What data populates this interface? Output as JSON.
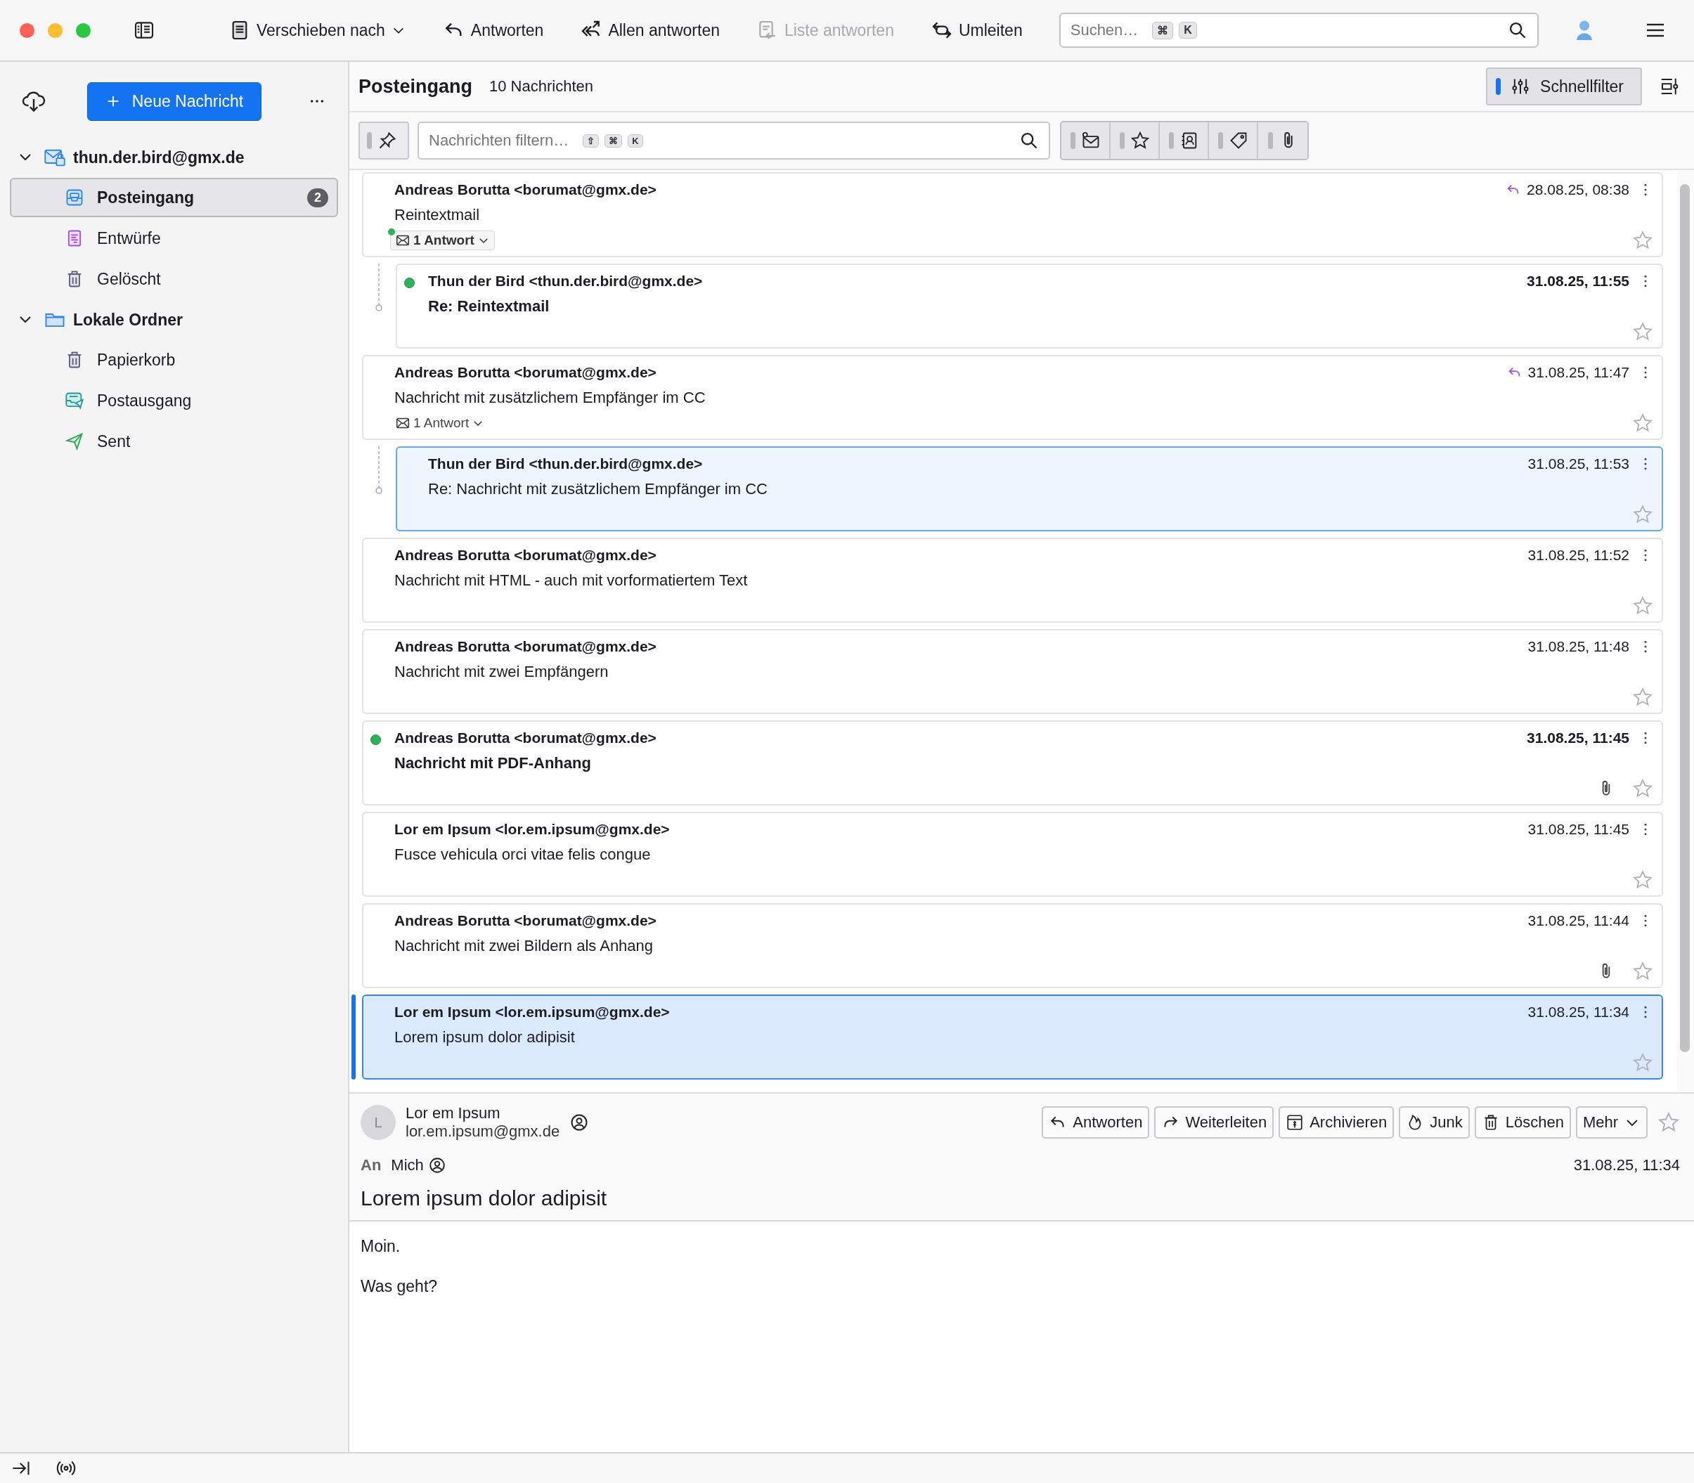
{
  "toolbar": {
    "buttons": [
      {
        "kind": "move",
        "label": "Verschieben nach",
        "disabled": false
      },
      {
        "kind": "reply",
        "label": "Antworten",
        "disabled": false
      },
      {
        "kind": "reply-all",
        "label": "Allen antworten",
        "disabled": false
      },
      {
        "kind": "reply-list",
        "label": "Liste antworten",
        "disabled": true
      },
      {
        "kind": "redirect",
        "label": "Umleiten",
        "disabled": false
      }
    ],
    "search": {
      "placeholder": "Suchen…",
      "keys": [
        "⌘",
        "K"
      ]
    }
  },
  "folder_pane": {
    "new_message": "Neue Nachricht",
    "accounts": [
      {
        "name": "thun.der.bird@gmx.de",
        "kind": "mail",
        "expanded": true,
        "children": [
          {
            "name": "Posteingang",
            "kind": "inbox",
            "selected": true,
            "unread_count": "2"
          },
          {
            "name": "Entwürfe",
            "kind": "drafts",
            "selected": false
          },
          {
            "name": "Gelöscht",
            "kind": "trash",
            "selected": false
          }
        ]
      },
      {
        "name": "Lokale Ordner",
        "kind": "local",
        "expanded": true,
        "children": [
          {
            "name": "Papierkorb",
            "kind": "trash",
            "selected": false
          },
          {
            "name": "Postausgang",
            "kind": "outbox",
            "selected": false
          },
          {
            "name": "Sent",
            "kind": "sent",
            "selected": false
          }
        ]
      }
    ]
  },
  "list_header": {
    "folder": "Posteingang",
    "count": "10 Nachrichten",
    "quick_filter": {
      "label": "Schnellfilter",
      "on": true
    }
  },
  "filter_bar": {
    "pinned": false,
    "placeholder": "Nachrichten filtern…",
    "keys": [
      "⇧",
      "⌘",
      "K"
    ],
    "toggles": [
      {
        "kind": "unread",
        "on": false
      },
      {
        "kind": "starred",
        "on": false
      },
      {
        "kind": "contact",
        "on": false
      },
      {
        "kind": "tags",
        "on": false
      },
      {
        "kind": "attachment",
        "on": false
      }
    ]
  },
  "messages": [
    {
      "sender": "Andreas Borutta <borumat@gmx.de>",
      "subject": "Reintextmail",
      "date": "28.08.25, 08:38",
      "unread": false,
      "replied": true,
      "selected": false,
      "highlighted": false,
      "attachment": false,
      "starred": false,
      "replies": {
        "label": "1 Antwort",
        "unread": true
      },
      "children": [
        {
          "sender": "Thun der Bird <thun.der.bird@gmx.de>",
          "subject": "Re: Reintextmail",
          "date": "31.08.25, 11:55",
          "unread": true,
          "replied": false,
          "selected": false,
          "highlighted": false,
          "attachment": false,
          "starred": false
        }
      ]
    },
    {
      "sender": "Andreas Borutta <borumat@gmx.de>",
      "subject": "Nachricht mit zusätzlichem Empfänger im CC",
      "date": "31.08.25, 11:47",
      "unread": false,
      "replied": true,
      "selected": false,
      "highlighted": false,
      "attachment": false,
      "starred": false,
      "replies": {
        "label": "1 Antwort",
        "unread": false
      },
      "children": [
        {
          "sender": "Thun der Bird <thun.der.bird@gmx.de>",
          "subject": "Re: Nachricht mit zusätzlichem Empfänger im CC",
          "date": "31.08.25, 11:53",
          "unread": false,
          "replied": false,
          "selected": false,
          "highlighted": true,
          "attachment": false,
          "starred": false
        }
      ]
    },
    {
      "sender": "Andreas Borutta <borumat@gmx.de>",
      "subject": "Nachricht mit HTML - auch mit vorformatiertem Text",
      "date": "31.08.25, 11:52",
      "unread": false,
      "replied": false,
      "selected": false,
      "highlighted": false,
      "attachment": false,
      "starred": false
    },
    {
      "sender": "Andreas Borutta <borumat@gmx.de>",
      "subject": "Nachricht mit zwei Empfängern",
      "date": "31.08.25, 11:48",
      "unread": false,
      "replied": false,
      "selected": false,
      "highlighted": false,
      "attachment": false,
      "starred": false
    },
    {
      "sender": "Andreas Borutta <borumat@gmx.de>",
      "subject": "Nachricht mit PDF-Anhang",
      "date": "31.08.25, 11:45",
      "unread": true,
      "replied": false,
      "selected": false,
      "highlighted": false,
      "attachment": true,
      "starred": false
    },
    {
      "sender": "Lor em Ipsum <lor.em.ipsum@gmx.de>",
      "subject": "Fusce vehicula orci vitae felis congue",
      "date": "31.08.25, 11:45",
      "unread": false,
      "replied": false,
      "selected": false,
      "highlighted": false,
      "attachment": false,
      "starred": false
    },
    {
      "sender": "Andreas Borutta <borumat@gmx.de>",
      "subject": "Nachricht mit zwei Bildern als Anhang",
      "date": "31.08.25, 11:44",
      "unread": false,
      "replied": false,
      "selected": false,
      "highlighted": false,
      "attachment": true,
      "starred": false
    },
    {
      "sender": "Lor em Ipsum <lor.em.ipsum@gmx.de>",
      "subject": "Lorem ipsum dolor adipisit",
      "date": "31.08.25, 11:34",
      "unread": false,
      "replied": false,
      "selected": true,
      "highlighted": false,
      "attachment": false,
      "starred": false
    }
  ],
  "reader": {
    "avatar": "L",
    "name": "Lor em Ipsum",
    "email": "lor.em.ipsum@gmx.de",
    "actions": [
      {
        "kind": "reply",
        "label": "Antworten"
      },
      {
        "kind": "forward",
        "label": "Weiterleiten"
      },
      {
        "kind": "archive",
        "label": "Archivieren"
      },
      {
        "kind": "junk",
        "label": "Junk"
      },
      {
        "kind": "delete",
        "label": "Löschen"
      },
      {
        "kind": "more",
        "label": "Mehr"
      }
    ],
    "starred": false,
    "to_label": "An",
    "to": "Mich",
    "date": "31.08.25, 11:34",
    "subject": "Lorem ipsum dolor adipisit",
    "body": [
      "Moin.",
      "Was geht?"
    ]
  }
}
